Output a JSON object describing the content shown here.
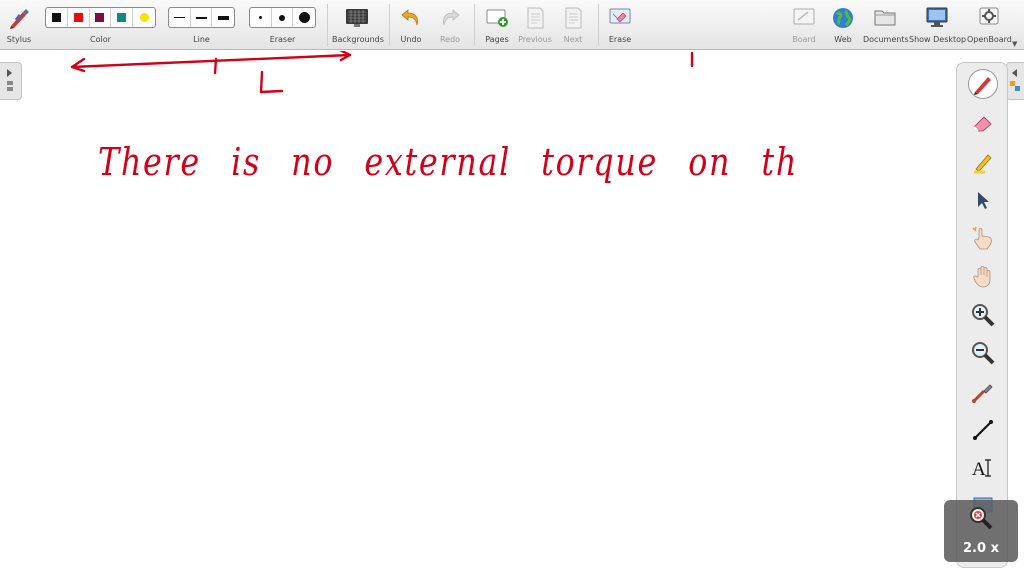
{
  "toolbar": {
    "stylus": "Stylus",
    "color": "Color",
    "line": "Line",
    "eraser": "Eraser",
    "backgrounds": "Backgrounds",
    "undo": "Undo",
    "redo": "Redo",
    "pages": "Pages",
    "previous": "Previous",
    "next": "Next",
    "erase": "Erase",
    "board": "Board",
    "web": "Web",
    "documents": "Documents",
    "show_desktop": "Show Desktop",
    "openboard": "OpenBoard"
  },
  "colors": {
    "swatches": [
      "#111111",
      "#e01010",
      "#7a1040",
      "#0e8a80",
      "#f5e300"
    ],
    "ink": "#d0021b",
    "selected_swatch": "#e01010"
  },
  "board": {
    "label_L": "L",
    "handwriting": "There is no external torque on th"
  },
  "palette": {
    "tools": [
      "pen-icon",
      "eraser-icon",
      "highlighter-icon",
      "selector-icon",
      "laser-pointer-icon",
      "hand-icon",
      "zoom-in-icon",
      "zoom-out-icon",
      "capture-icon",
      "line-icon",
      "text-icon",
      "rectangle-icon"
    ]
  },
  "zoom": {
    "level": "2.0 x"
  }
}
